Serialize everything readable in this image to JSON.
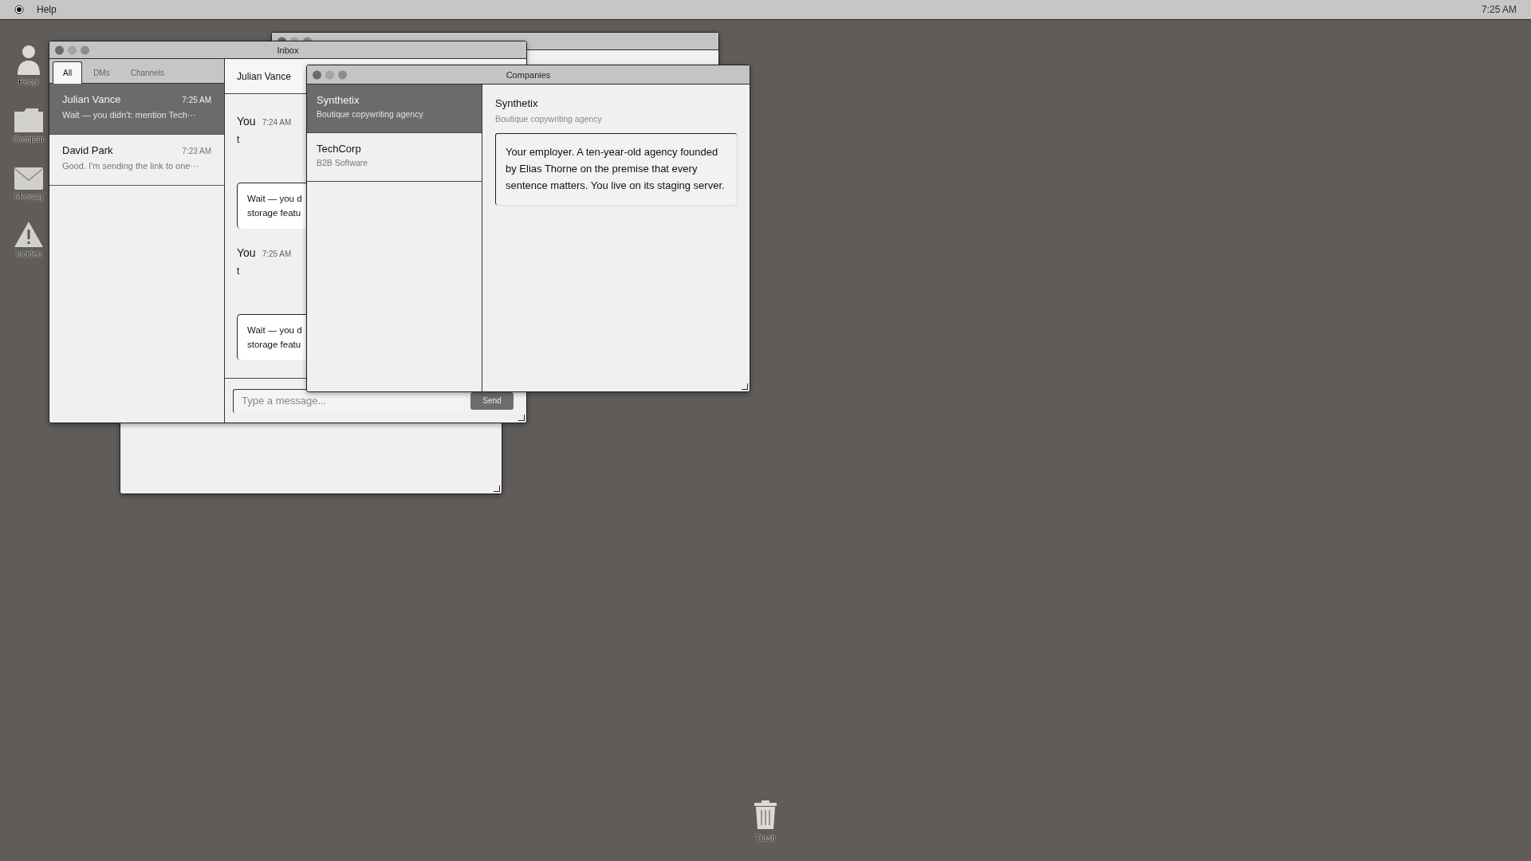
{
  "menu_bar": {
    "items": [
      "Help"
    ],
    "clock": "7:25 AM"
  },
  "desktop_icons": [
    {
      "kind": "person",
      "label": "Peopl"
    },
    {
      "kind": "folder",
      "label": "Compan"
    },
    {
      "kind": "envelope",
      "label": "Messag"
    },
    {
      "kind": "warning",
      "label": "Inciden"
    }
  ],
  "inbox": {
    "title": "Inbox",
    "tabs": [
      {
        "label": "All",
        "selected": true
      },
      {
        "label": "DMs",
        "selected": false
      },
      {
        "label": "Channels",
        "selected": false
      }
    ],
    "conversations": [
      {
        "name": "Julian Vance",
        "time": "7:25 AM",
        "preview": "Wait — you didn't: mention Tech···",
        "selected": true
      },
      {
        "name": "David Park",
        "time": "7:23 AM",
        "preview": "Good. I'm sending the link to one···",
        "selected": false
      }
    ],
    "thread": {
      "header": "Julian Vance",
      "messages": [
        {
          "kind": "own",
          "author": "You",
          "time": "7:24 AM",
          "text": "t"
        },
        {
          "kind": "bubble",
          "lines": [
            "Wait — you d",
            "storage featu"
          ]
        },
        {
          "kind": "own",
          "author": "You",
          "time": "7:25 AM",
          "text": "t"
        },
        {
          "kind": "bubble",
          "lines": [
            "Wait — you d",
            "storage featu"
          ]
        }
      ]
    },
    "composer": {
      "placeholder": "Type a message...",
      "send": "Send"
    }
  },
  "companies": {
    "title": "Companies",
    "items": [
      {
        "name": "Synthetix",
        "tagline": "Boutique copywriting agency",
        "selected": true
      },
      {
        "name": "TechCorp",
        "tagline": "B2B Software",
        "selected": false
      }
    ],
    "detail": {
      "name": "Synthetix",
      "tagline": "Boutique copywriting agency",
      "description": "Your employer. A ten-year-old agency founded by Elias Thorne on the premise that every sentence matters. You live on its staging server."
    }
  },
  "trash": {
    "label": "Trash"
  }
}
